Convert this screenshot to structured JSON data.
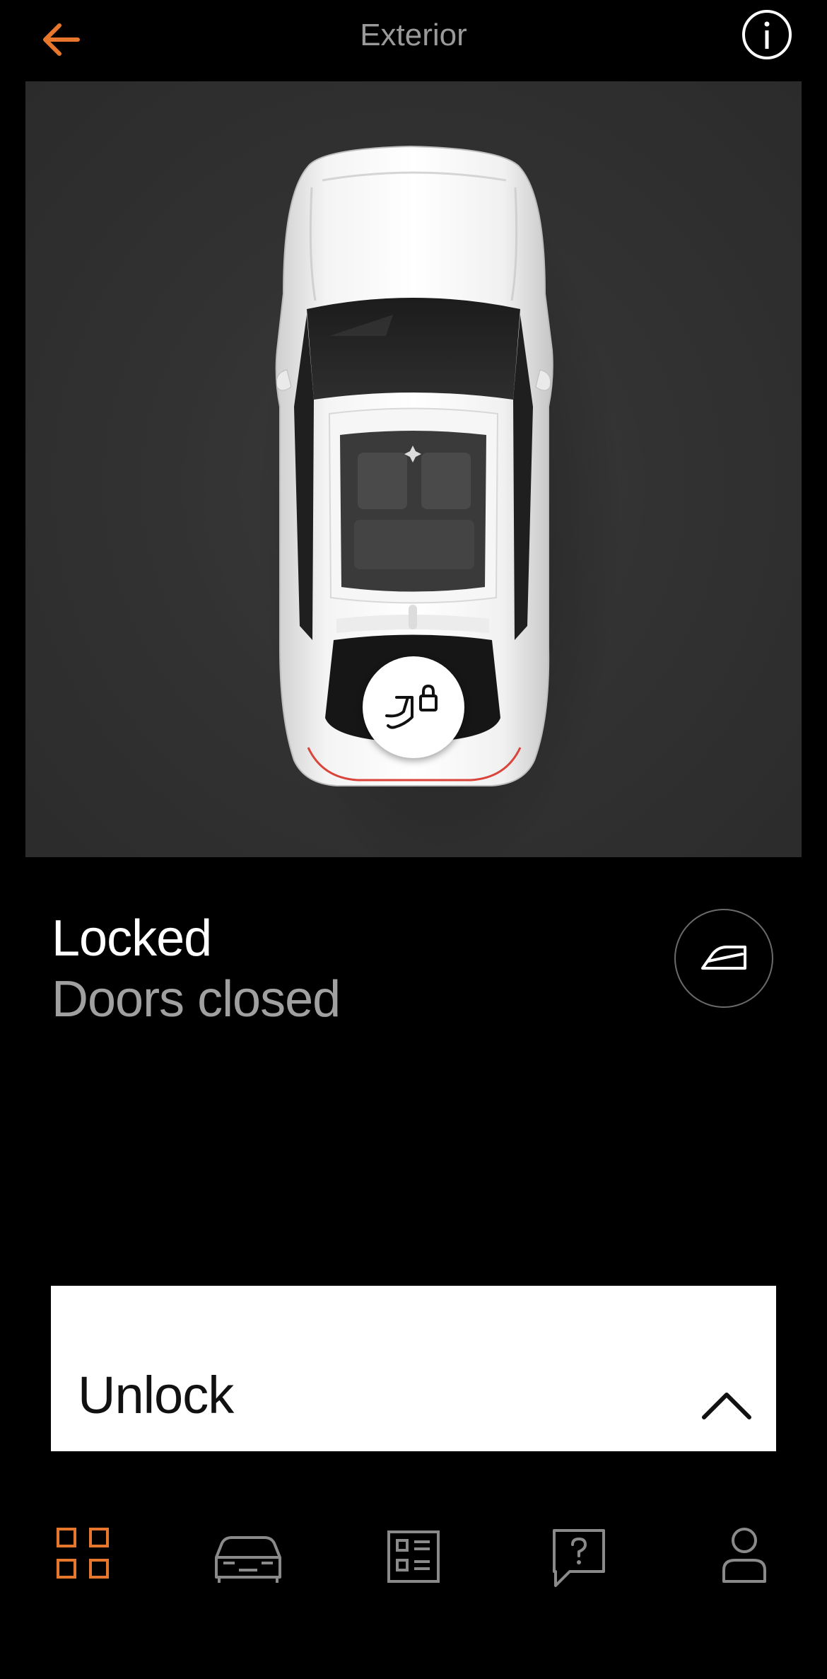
{
  "header": {
    "title": "Exterior",
    "back_icon": "arrow-left-icon",
    "info_icon": "info-icon"
  },
  "hero": {
    "trunk_icon": "trunk-locked-icon"
  },
  "status": {
    "lock_state": "Locked",
    "doors_state": "Doors closed",
    "window_icon": "car-window-icon"
  },
  "action": {
    "unlock_label": "Unlock",
    "expand_icon": "chevron-up-icon"
  },
  "nav": {
    "items": [
      {
        "icon": "dashboard-grid-icon",
        "active": true
      },
      {
        "icon": "car-icon",
        "active": false
      },
      {
        "icon": "list-icon",
        "active": false
      },
      {
        "icon": "help-chat-icon",
        "active": false
      },
      {
        "icon": "profile-icon",
        "active": false
      }
    ]
  },
  "colors": {
    "accent": "#E8772E",
    "background": "#000000",
    "hero_background": "#323232",
    "primary_text": "#FFFFFF",
    "secondary_text": "#A0A0A0",
    "icon_inactive": "#8A8A8A"
  }
}
